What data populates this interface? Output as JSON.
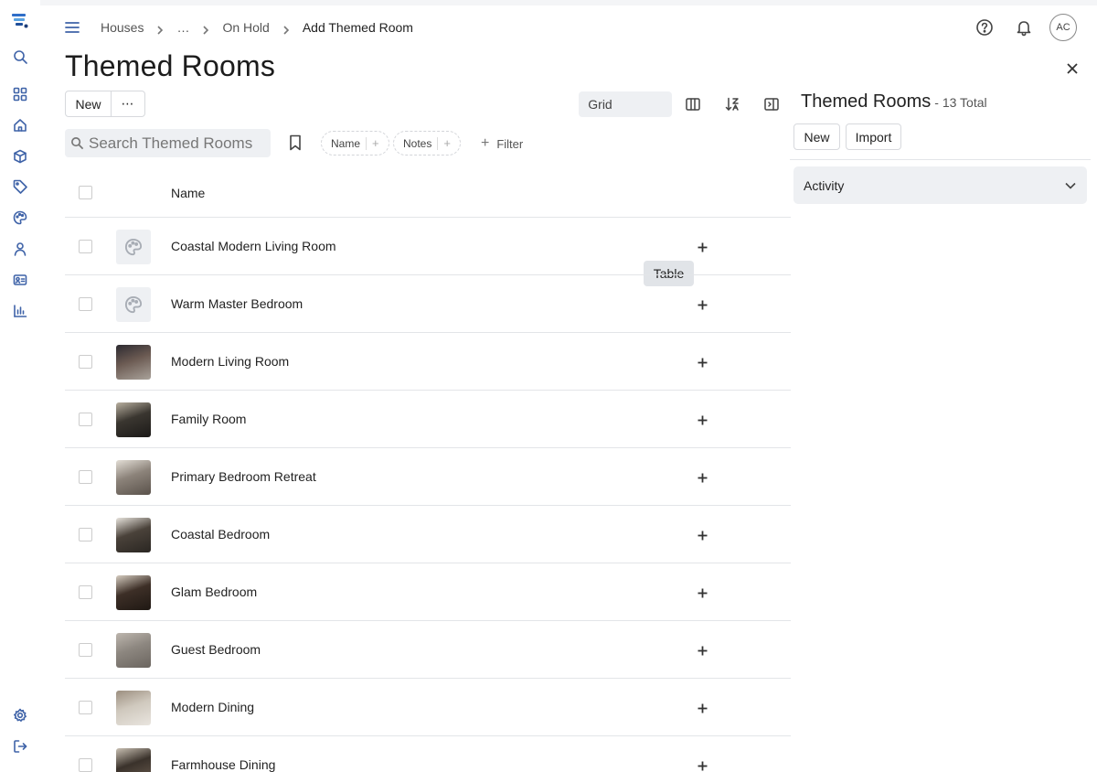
{
  "breadcrumb": {
    "items": [
      "Houses",
      "…",
      "On Hold",
      "Add Themed Room"
    ]
  },
  "header": {
    "title": "Themed Rooms",
    "avatar_initials": "AC"
  },
  "toolbar": {
    "new_label": "New",
    "more_label": "⋯",
    "view_table": "Table",
    "view_grid": "Grid",
    "active_view": "Table"
  },
  "search": {
    "placeholder": "Search Themed Rooms"
  },
  "chips": [
    {
      "label": "Name",
      "plus": "+"
    },
    {
      "label": "Notes",
      "plus": "+"
    }
  ],
  "filter": {
    "label": "Filter",
    "plus": "+"
  },
  "table": {
    "column_name": "Name",
    "rows": [
      {
        "name": "Coastal Modern Living Room",
        "thumb": "placeholder"
      },
      {
        "name": "Warm Master Bedroom",
        "thumb": "placeholder"
      },
      {
        "name": "Modern Living Room",
        "thumb": "photo",
        "colors": [
          "#6b5a52",
          "#2c2a30",
          "#a9a29a"
        ]
      },
      {
        "name": "Family Room",
        "thumb": "photo",
        "colors": [
          "#3a3630",
          "#b9b0a0",
          "#1c1a18"
        ]
      },
      {
        "name": "Primary Bedroom Retreat",
        "thumb": "photo",
        "colors": [
          "#8c837a",
          "#e3ded6",
          "#5a524b"
        ]
      },
      {
        "name": "Coastal Bedroom",
        "thumb": "photo",
        "colors": [
          "#4a423a",
          "#e8e4dd",
          "#2a2622"
        ]
      },
      {
        "name": "Glam Bedroom",
        "thumb": "photo",
        "colors": [
          "#3d2f27",
          "#d6cdc1",
          "#1f1813"
        ]
      },
      {
        "name": "Guest Bedroom",
        "thumb": "photo",
        "colors": [
          "#8d8780",
          "#bdb6ae",
          "#6b655f"
        ]
      },
      {
        "name": "Modern Dining",
        "thumb": "photo",
        "colors": [
          "#cfc8bd",
          "#9c8f80",
          "#e9e5df"
        ]
      },
      {
        "name": "Farmhouse Dining",
        "thumb": "photo",
        "colors": [
          "#3a322b",
          "#c9c0b3",
          "#6a5c4f"
        ]
      }
    ]
  },
  "panel": {
    "title": "Themed Rooms",
    "count_text": "- 13 Total",
    "new_label": "New",
    "import_label": "Import",
    "activity_label": "Activity"
  },
  "colors": {
    "accent": "#3f63a8",
    "subtle_bg": "#eef0f3",
    "border": "#e3e5e8"
  }
}
